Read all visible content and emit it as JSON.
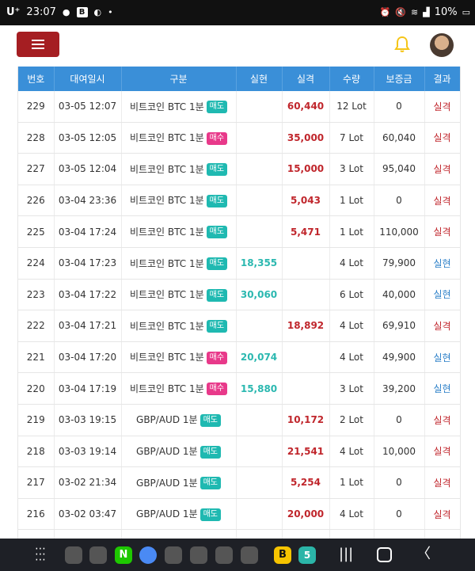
{
  "status_bar": {
    "carrier": "U⁺",
    "time": "23:07",
    "battery": "10%",
    "left_icons": [
      "chat-icon",
      "b-app-icon",
      "app-icon",
      "dot-icon"
    ],
    "right_icons": [
      "alarm-icon",
      "mute-icon",
      "wifi-icon",
      "signal-icon",
      "battery-icon"
    ]
  },
  "header": {
    "menu_icon": "hamburger-icon",
    "bell_icon": "bell-icon",
    "colors": {
      "menu_bg": "#a51e22",
      "bell": "#f5c518"
    }
  },
  "table": {
    "columns": [
      "번호",
      "대여일시",
      "구분",
      "실현",
      "실격",
      "수량",
      "보증금",
      "결과"
    ],
    "colors": {
      "header_bg": "#3a8fd8",
      "fail": "#c0262c",
      "ok": "#2b7fc8",
      "sell_badge": "#1fb9b1",
      "buy_badge": "#e8398a"
    },
    "rows": [
      {
        "no": "229",
        "datetime": "03-05 12:07",
        "item": "비트코인 BTC 1분",
        "badge": "매도",
        "badge_type": "sell",
        "realized": "",
        "loss": "60,440",
        "qty": "12 Lot",
        "deposit": "0",
        "result": "실격",
        "result_type": "fail"
      },
      {
        "no": "228",
        "datetime": "03-05 12:05",
        "item": "비트코인 BTC 1분",
        "badge": "매수",
        "badge_type": "buy",
        "realized": "",
        "loss": "35,000",
        "qty": "7 Lot",
        "deposit": "60,040",
        "result": "실격",
        "result_type": "fail"
      },
      {
        "no": "227",
        "datetime": "03-05 12:04",
        "item": "비트코인 BTC 1분",
        "badge": "매도",
        "badge_type": "sell",
        "realized": "",
        "loss": "15,000",
        "qty": "3 Lot",
        "deposit": "95,040",
        "result": "실격",
        "result_type": "fail"
      },
      {
        "no": "226",
        "datetime": "03-04 23:36",
        "item": "비트코인 BTC 1분",
        "badge": "매도",
        "badge_type": "sell",
        "realized": "",
        "loss": "5,043",
        "qty": "1 Lot",
        "deposit": "0",
        "result": "실격",
        "result_type": "fail"
      },
      {
        "no": "225",
        "datetime": "03-04 17:24",
        "item": "비트코인 BTC 1분",
        "badge": "매도",
        "badge_type": "sell",
        "realized": "",
        "loss": "5,471",
        "qty": "1 Lot",
        "deposit": "110,000",
        "result": "실격",
        "result_type": "fail"
      },
      {
        "no": "224",
        "datetime": "03-04 17:23",
        "item": "비트코인 BTC 1분",
        "badge": "매도",
        "badge_type": "sell",
        "realized": "18,355",
        "loss": "",
        "qty": "4 Lot",
        "deposit": "79,900",
        "result": "실현",
        "result_type": "ok"
      },
      {
        "no": "223",
        "datetime": "03-04 17:22",
        "item": "비트코인 BTC 1분",
        "badge": "매도",
        "badge_type": "sell",
        "realized": "30,060",
        "loss": "",
        "qty": "6 Lot",
        "deposit": "40,000",
        "result": "실현",
        "result_type": "ok"
      },
      {
        "no": "222",
        "datetime": "03-04 17:21",
        "item": "비트코인 BTC 1분",
        "badge": "매도",
        "badge_type": "sell",
        "realized": "",
        "loss": "18,892",
        "qty": "4 Lot",
        "deposit": "69,910",
        "result": "실격",
        "result_type": "fail"
      },
      {
        "no": "221",
        "datetime": "03-04 17:20",
        "item": "비트코인 BTC 1분",
        "badge": "매수",
        "badge_type": "buy",
        "realized": "20,074",
        "loss": "",
        "qty": "4 Lot",
        "deposit": "49,900",
        "result": "실현",
        "result_type": "ok"
      },
      {
        "no": "220",
        "datetime": "03-04 17:19",
        "item": "비트코인 BTC 1분",
        "badge": "매수",
        "badge_type": "buy",
        "realized": "15,880",
        "loss": "",
        "qty": "3 Lot",
        "deposit": "39,200",
        "result": "실현",
        "result_type": "ok"
      },
      {
        "no": "219",
        "datetime": "03-03 19:15",
        "item": "GBP/AUD 1분",
        "badge": "매도",
        "badge_type": "sell",
        "realized": "",
        "loss": "10,172",
        "qty": "2 Lot",
        "deposit": "0",
        "result": "실격",
        "result_type": "fail"
      },
      {
        "no": "218",
        "datetime": "03-03 19:14",
        "item": "GBP/AUD 1분",
        "badge": "매도",
        "badge_type": "sell",
        "realized": "",
        "loss": "21,541",
        "qty": "4 Lot",
        "deposit": "10,000",
        "result": "실격",
        "result_type": "fail"
      },
      {
        "no": "217",
        "datetime": "03-02 21:34",
        "item": "GBP/AUD 1분",
        "badge": "매도",
        "badge_type": "sell",
        "realized": "",
        "loss": "5,254",
        "qty": "1 Lot",
        "deposit": "0",
        "result": "실격",
        "result_type": "fail"
      },
      {
        "no": "216",
        "datetime": "03-02 03:47",
        "item": "GBP/AUD 1분",
        "badge": "매도",
        "badge_type": "sell",
        "realized": "",
        "loss": "20,000",
        "qty": "4 Lot",
        "deposit": "0",
        "result": "실격",
        "result_type": "fail"
      }
    ]
  },
  "nav_bar": {
    "app_icons": [
      "app-folder-icon",
      "app-folder-icon",
      "naver-icon",
      "translate-icon",
      "app-folder-icon",
      "app-folder-icon",
      "app-folder-icon",
      "app-folder-icon",
      "b-app-icon",
      "calendar-icon"
    ],
    "naver_label": "N",
    "b_label": "B",
    "calendar_label": "5",
    "buttons": [
      "recents-icon",
      "home-icon",
      "back-icon"
    ]
  }
}
